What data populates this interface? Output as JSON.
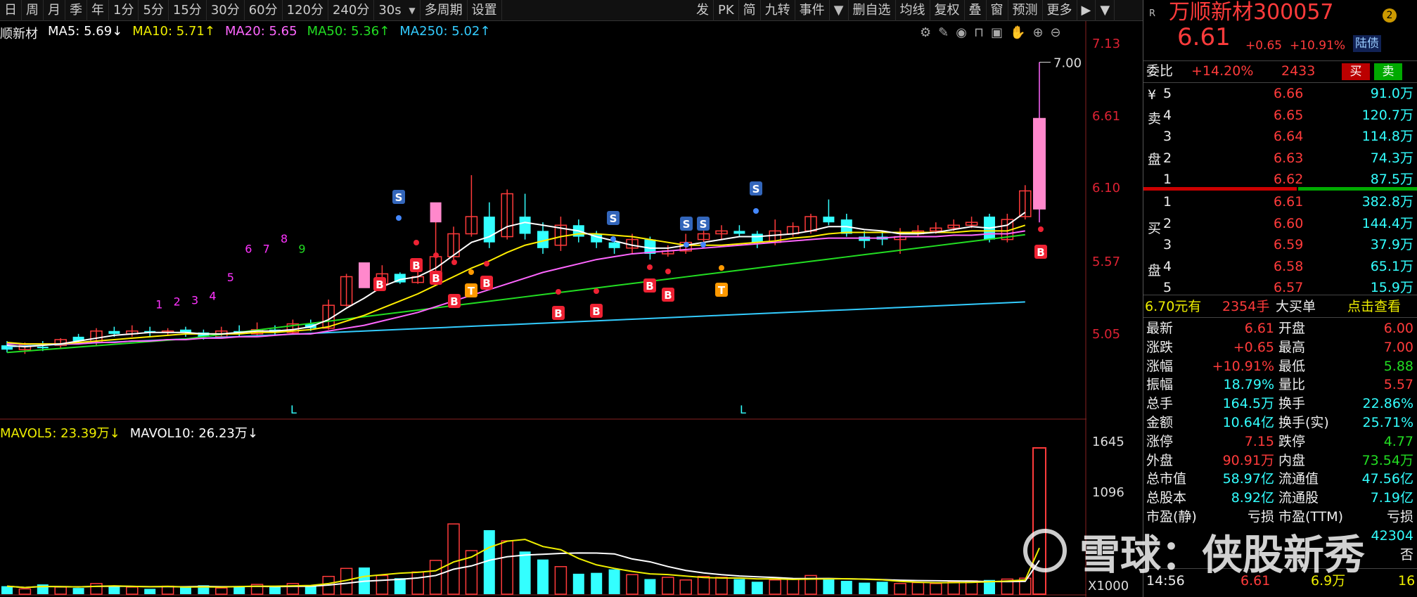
{
  "toolbar": {
    "left": [
      "日",
      "周",
      "月",
      "季",
      "年",
      "1分",
      "5分",
      "15分",
      "30分",
      "60分",
      "120分",
      "240分"
    ],
    "period_select": "30s",
    "multi_period": "多周期",
    "settings": "设置",
    "right": [
      "发",
      "PK",
      "简",
      "九转",
      "事件"
    ],
    "right2": [
      "删自选",
      "均线",
      "复权",
      "叠",
      "窗",
      "预测",
      "更多"
    ],
    "extra": [
      "▶",
      "▼"
    ]
  },
  "ma": {
    "name_partial": "顺新材",
    "ma5": "MA5: 5.69↓",
    "ma10": "MA10: 5.71↑",
    "ma20": "MA20: 5.65",
    "ma50": "MA50: 5.36↑",
    "ma250": "MA250: 5.02↑"
  },
  "colors": {
    "up": "#ff3b3b",
    "down": "#3ff",
    "ma5": "#ffffff",
    "ma10": "#ffee00",
    "ma20": "#ff66ff",
    "ma50": "#22dd22",
    "ma250": "#33ccff"
  },
  "axis": {
    "price_ticks": [
      "7.13",
      "6.61",
      "6.10",
      "5.57",
      "5.05"
    ],
    "vol_ticks": [
      "1645",
      "1096",
      "X1000"
    ],
    "high_note": "7.00"
  },
  "volume": {
    "mavol5": "MAVOL5: 23.39万↓",
    "mavol10": "MAVOL10: 26.23万↓"
  },
  "markers": {
    "buy": "B",
    "sell": "S",
    "t": "T",
    "low": "L",
    "counts": [
      "1",
      "2",
      "3",
      "4",
      "5",
      "6",
      "7",
      "8",
      "9"
    ]
  },
  "quote": {
    "R": "R",
    "name": "万顺新材",
    "code": "300057",
    "badge": "2",
    "price": "6.61",
    "change": "+0.65",
    "pct": "+10.91%",
    "tag": "陆债",
    "weibi_label": "委比",
    "weibi": "+14.20%",
    "weicha": "2433",
    "buy_btn": "买",
    "sell_btn": "卖",
    "sell_side": [
      {
        "n": "5",
        "p": "6.66",
        "v": "91.0万"
      },
      {
        "n": "4",
        "p": "6.65",
        "v": "120.7万"
      },
      {
        "n": "3",
        "p": "6.64",
        "v": "114.8万"
      },
      {
        "n": "2",
        "p": "6.63",
        "v": "74.3万"
      },
      {
        "n": "1",
        "p": "6.62",
        "v": "87.5万"
      }
    ],
    "sell_label": [
      "¥",
      "卖",
      "盘"
    ],
    "buy_side": [
      {
        "n": "1",
        "p": "6.61",
        "v": "382.8万"
      },
      {
        "n": "2",
        "p": "6.60",
        "v": "144.4万"
      },
      {
        "n": "3",
        "p": "6.59",
        "v": "37.9万"
      },
      {
        "n": "4",
        "p": "6.58",
        "v": "65.1万"
      },
      {
        "n": "5",
        "p": "6.57",
        "v": "15.9万"
      }
    ],
    "buy_label": [
      "买",
      "盘"
    ],
    "big_order": {
      "price": "6.70元有",
      "qty": "2354手",
      "type": "大买单",
      "link": "点击查看"
    },
    "stats": [
      {
        "k1": "最新",
        "v1": "6.61",
        "c1": "red",
        "k2": "开盘",
        "v2": "6.00",
        "c2": "red"
      },
      {
        "k1": "涨跌",
        "v1": "+0.65",
        "c1": "red",
        "k2": "最高",
        "v2": "7.00",
        "c2": "red"
      },
      {
        "k1": "涨幅",
        "v1": "+10.91%",
        "c1": "red",
        "k2": "最低",
        "v2": "5.88",
        "c2": "green"
      },
      {
        "k1": "振幅",
        "v1": "18.79%",
        "c1": "cyan",
        "k2": "量比",
        "v2": "5.57",
        "c2": "red"
      },
      {
        "k1": "总手",
        "v1": "164.5万",
        "c1": "cyan",
        "k2": "换手",
        "v2": "22.86%",
        "c2": "cyan"
      },
      {
        "k1": "金额",
        "v1": "10.64亿",
        "c1": "cyan",
        "k2": "换手(实)",
        "v2": "25.71%",
        "c2": "cyan"
      },
      {
        "k1": "涨停",
        "v1": "7.15",
        "c1": "red",
        "k2": "跌停",
        "v2": "4.77",
        "c2": "green"
      },
      {
        "k1": "外盘",
        "v1": "90.91万",
        "c1": "red",
        "k2": "内盘",
        "v2": "73.54万",
        "c2": "green"
      },
      {
        "k1": "总市值",
        "v1": "58.97亿",
        "c1": "cyan",
        "k2": "流通值",
        "v2": "47.56亿",
        "c2": "cyan"
      },
      {
        "k1": "总股本",
        "v1": "8.92亿",
        "c1": "cyan",
        "k2": "流通股",
        "v2": "7.19亿",
        "c2": "cyan"
      },
      {
        "k1": "市盈(静)",
        "v1": "亏损",
        "c1": "white",
        "k2": "市盈(TTM)",
        "v2": "亏损",
        "c2": "white"
      },
      {
        "k1": "",
        "v1": "",
        "c1": "white",
        "k2": "",
        "v2": "42304",
        "c2": "cyan"
      },
      {
        "k1": "",
        "v1": "",
        "c1": "white",
        "k2": "",
        "v2": "否",
        "c2": "white"
      }
    ],
    "tick": {
      "time": "14:56",
      "price": "6.61",
      "vol": "6.9万",
      "num": "16"
    }
  },
  "watermark": "雪球：侠股新秀"
}
